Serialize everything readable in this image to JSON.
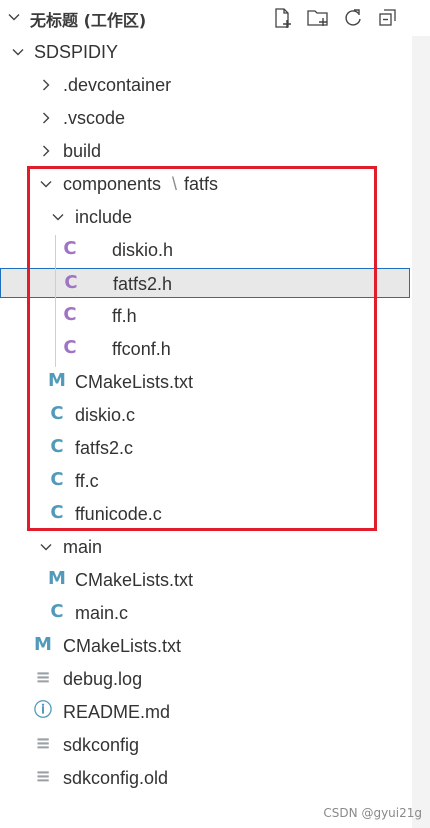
{
  "header": {
    "title": "无标题 (工作区)",
    "actions": [
      {
        "name": "new-file-icon"
      },
      {
        "name": "new-folder-icon"
      },
      {
        "name": "refresh-icon"
      },
      {
        "name": "collapse-all-icon"
      }
    ]
  },
  "tree": [
    {
      "label": "SDSPIDIY",
      "type": "folder",
      "expanded": true,
      "depth": 0
    },
    {
      "label": ".devcontainer",
      "type": "folder",
      "expanded": false,
      "depth": 1
    },
    {
      "label": ".vscode",
      "type": "folder",
      "expanded": false,
      "depth": 1
    },
    {
      "label": "build",
      "type": "folder",
      "expanded": false,
      "depth": 1
    },
    {
      "label": "components",
      "label_suffix": "fatfs",
      "type": "folder",
      "expanded": true,
      "depth": 1
    },
    {
      "label": "include",
      "type": "folder",
      "expanded": true,
      "depth": 2
    },
    {
      "label": "diskio.h",
      "type": "file",
      "icon": "C",
      "depth": 3
    },
    {
      "label": "fatfs2.h",
      "type": "file",
      "icon": "C",
      "depth": 3,
      "selected": true
    },
    {
      "label": "ff.h",
      "type": "file",
      "icon": "C",
      "depth": 3
    },
    {
      "label": "ffconf.h",
      "type": "file",
      "icon": "C",
      "depth": 3
    },
    {
      "label": "CMakeLists.txt",
      "type": "file",
      "icon": "M",
      "depth": 2
    },
    {
      "label": "diskio.c",
      "type": "file",
      "icon": "C",
      "depth": 2
    },
    {
      "label": "fatfs2.c",
      "type": "file",
      "icon": "C",
      "depth": 2
    },
    {
      "label": "ff.c",
      "type": "file",
      "icon": "C",
      "depth": 2
    },
    {
      "label": "ffunicode.c",
      "type": "file",
      "icon": "C",
      "depth": 2
    },
    {
      "label": "main",
      "type": "folder",
      "expanded": true,
      "depth": 1
    },
    {
      "label": "CMakeLists.txt",
      "type": "file",
      "icon": "M",
      "depth": 2
    },
    {
      "label": "main.c",
      "type": "file",
      "icon": "C",
      "depth": 2
    },
    {
      "label": "CMakeLists.txt",
      "type": "file",
      "icon": "M",
      "depth": 1
    },
    {
      "label": "debug.log",
      "type": "file",
      "icon": "≡",
      "depth": 1
    },
    {
      "label": "README.md",
      "type": "file",
      "icon": "ⓘ",
      "depth": 1
    },
    {
      "label": "sdkconfig",
      "type": "file",
      "icon": "≡",
      "depth": 1
    },
    {
      "label": "sdkconfig.old",
      "type": "file",
      "icon": "≡",
      "depth": 1
    }
  ],
  "colors": {
    "c_header": "#a074c4",
    "c_source": "#519aba",
    "cmake": "#519aba",
    "highlight_box": "#e11d2b",
    "selection_border": "#1f6fbf"
  },
  "watermark": "CSDN @gyui21g"
}
